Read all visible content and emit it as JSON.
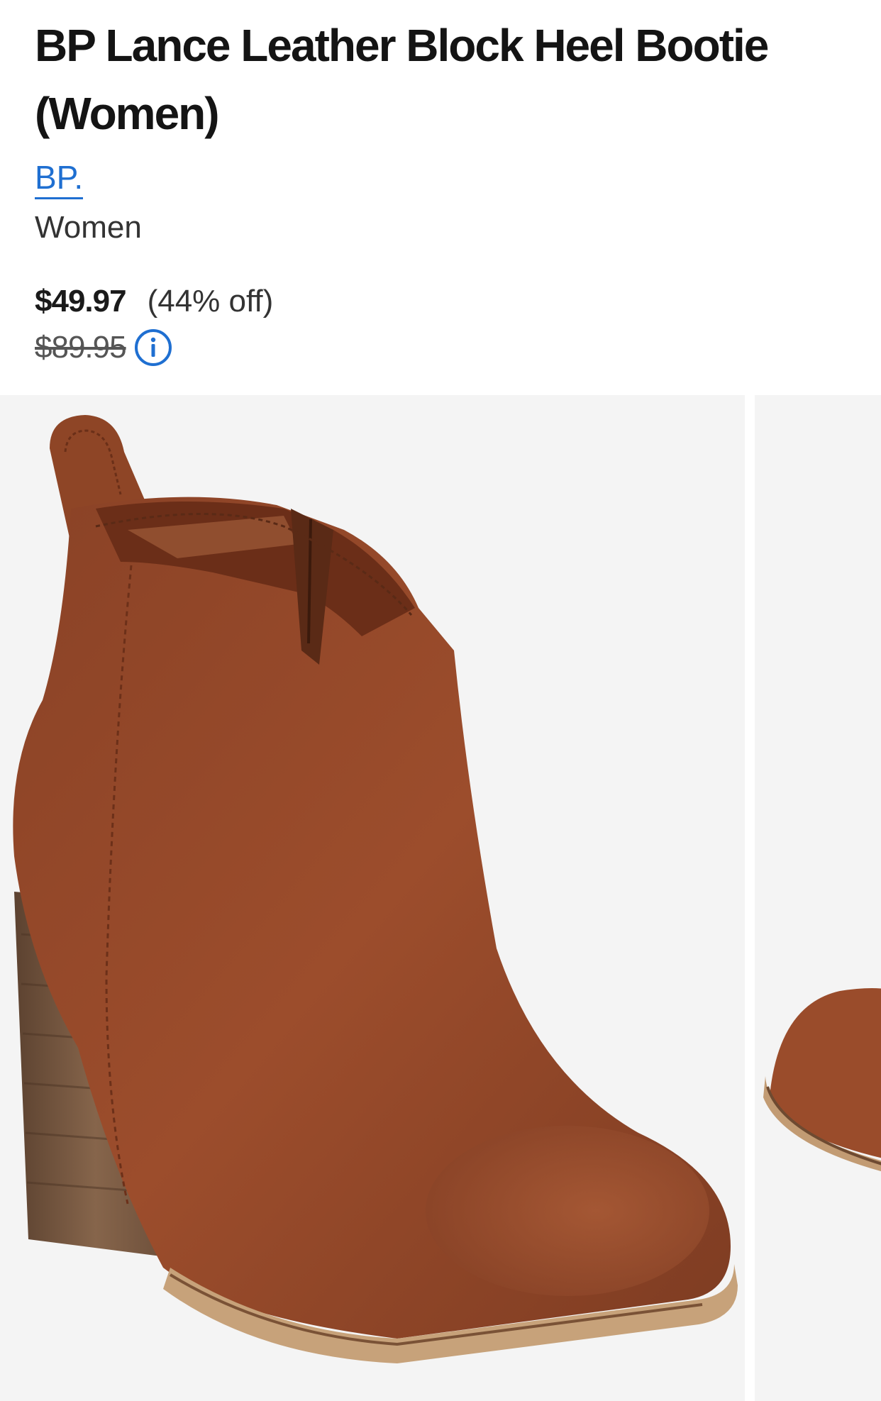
{
  "product": {
    "title": "BP Lance Leather Block Heel Bootie (Women)",
    "brand": "BP.",
    "category": "Women"
  },
  "pricing": {
    "current": "$49.97",
    "discount": "(44% off)",
    "original": "$89.95"
  },
  "icons": {
    "info": "info-circle-icon"
  },
  "colors": {
    "link": "#1f6fd1",
    "leather": "#94482a",
    "heel": "#7a5a43",
    "image_background": "#f4f4f4"
  },
  "gallery": {
    "images": [
      {
        "alt": "product-image-boot-side"
      },
      {
        "alt": "product-image-boot-toe"
      }
    ]
  }
}
